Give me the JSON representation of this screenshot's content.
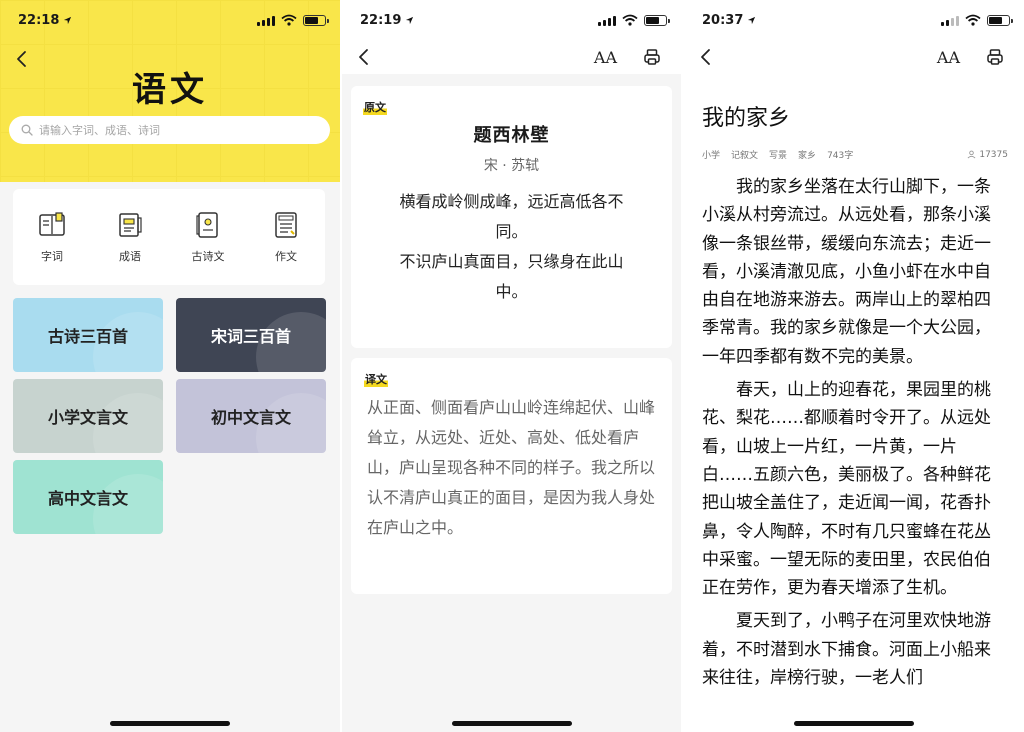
{
  "screens": [
    {
      "status_time": "22:18",
      "title": "语文",
      "search": {
        "placeholder": "请输入字词、成语、诗词"
      },
      "tools": [
        {
          "label": "字词",
          "icon": "dictionary-icon"
        },
        {
          "label": "成语",
          "icon": "idiom-book-icon"
        },
        {
          "label": "古诗文",
          "icon": "classic-poem-icon"
        },
        {
          "label": "作文",
          "icon": "essay-icon"
        }
      ],
      "cards": [
        {
          "label": "古诗三百首",
          "color": "#a9dcef"
        },
        {
          "label": "宋词三百首",
          "color": "#3f4554"
        },
        {
          "label": "小学文言文",
          "color": "#c7d3cf"
        },
        {
          "label": "初中文言文",
          "color": "#c3c3d9"
        },
        {
          "label": "高中文言文",
          "color": "#9fe3d2"
        }
      ],
      "accent": "#f9e64a"
    },
    {
      "status_time": "22:19",
      "font_button": "AA",
      "original_tag": "原文",
      "poem_title": "题西林壁",
      "poem_author": "宋 · 苏轼",
      "poem_lines": [
        "横看成岭侧成峰，远近高低各不同。",
        "不识庐山真面目，只缘身在此山中。"
      ],
      "translation_tag": "译文",
      "translation": "从正面、侧面看庐山山岭连绵起伏、山峰耸立，从远处、近处、高处、低处看庐山，庐山呈现各种不同的样子。我之所以认不清庐山真正的面目，是因为我人身处在庐山之中。"
    },
    {
      "status_time": "20:37",
      "essay_title": "我的家乡",
      "meta": {
        "tags": [
          "小学",
          "记叙文",
          "写景",
          "家乡",
          "743字"
        ],
        "views": "17375"
      },
      "paragraphs": [
        "我的家乡坐落在太行山脚下，一条小溪从村旁流过。从远处看，那条小溪像一条银丝带，缓缓向东流去；走近一看，小溪清澈见底，小鱼小虾在水中自由自在地游来游去。两岸山上的翠柏四季常青。我的家乡就像是一个大公园，一年四季都有数不完的美景。",
        "春天，山上的迎春花，果园里的桃花、梨花……都顺着时令开了。从远处看，山坡上一片红，一片黄，一片白……五颜六色，美丽极了。各种鲜花把山坡全盖住了，走近闻一闻，花香扑鼻，令人陶醉，不时有几只蜜蜂在花丛中采蜜。一望无际的麦田里，农民伯伯正在劳作，更为春天增添了生机。",
        "夏天到了，小鸭子在河里欢快地游着，不时潜到水下捕食。河面上小船来来往往，岸榜行驶，一老人们"
      ]
    }
  ]
}
